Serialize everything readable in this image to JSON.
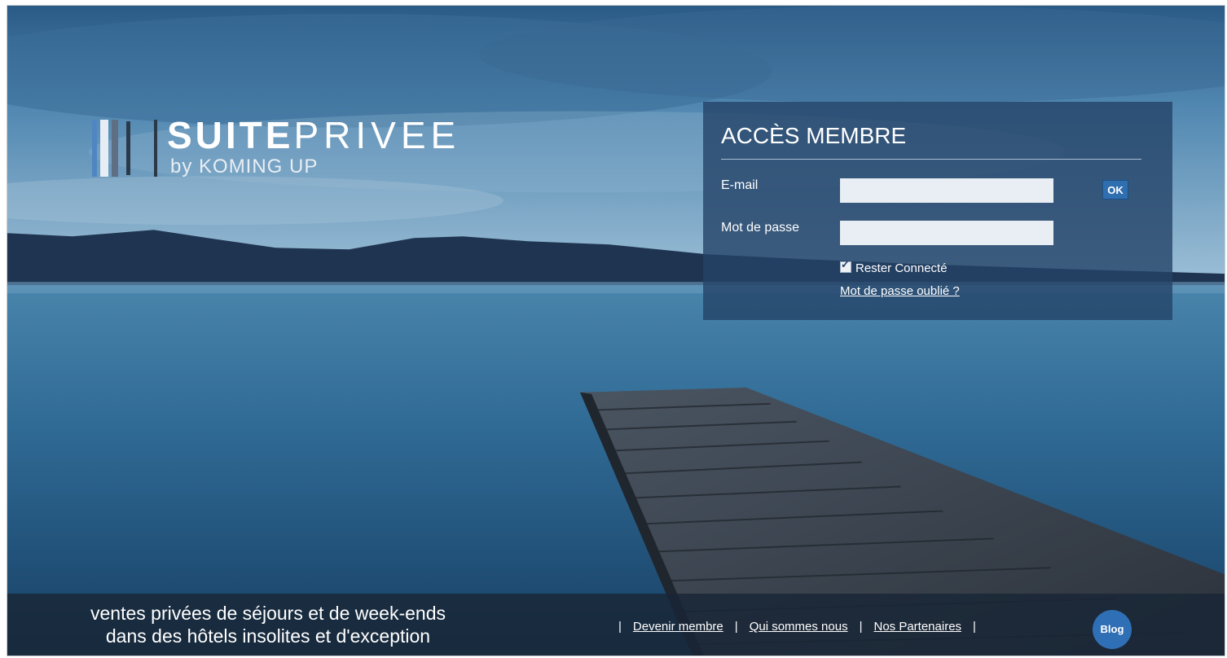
{
  "brand": {
    "name_bold": "SUITE",
    "name_light": "PRIVEE",
    "byline": "by KOMING UP"
  },
  "login": {
    "title": "ACCÈS MEMBRE",
    "email_label": "E-mail",
    "email_value": "",
    "password_label": "Mot de passe",
    "password_value": "",
    "ok_label": "OK",
    "remember_label": "Rester Connecté",
    "remember_checked": true,
    "forgot_link": "Mot de passe oublié ?"
  },
  "footer": {
    "slogan_line1": "ventes privées de séjours et de week-ends",
    "slogan_line2": "dans des hôtels insolites et d'exception",
    "links": [
      "Devenir membre",
      "Qui sommes nous",
      "Nos Partenaires"
    ],
    "separator": "|",
    "blog_label": "Blog"
  },
  "colors": {
    "panel": "#244468",
    "button": "#2f6fb0",
    "bar": "#182636"
  }
}
